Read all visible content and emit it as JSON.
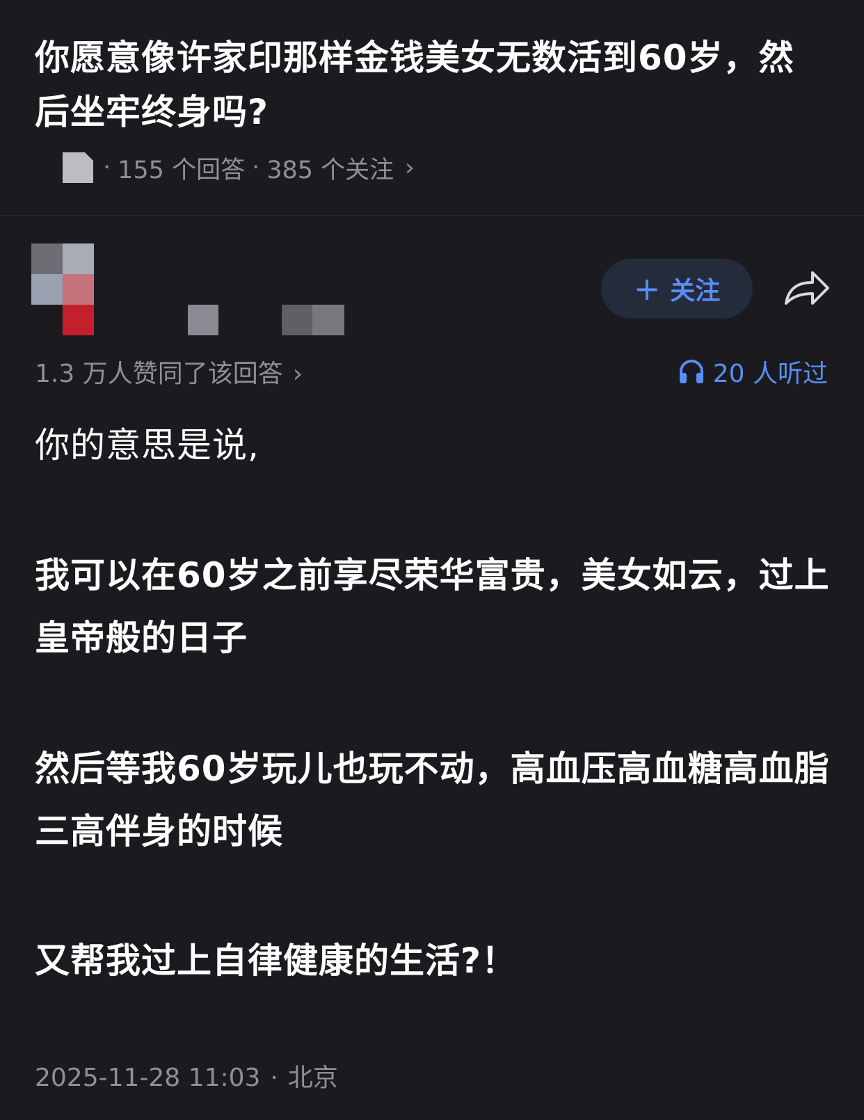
{
  "question": {
    "title": "你愿意像许家印那样金钱美女无数活到60岁，然后坐牢终身吗?",
    "answers_count": "155 个回答",
    "followers_count": "385 个关注",
    "separator": "·",
    "chevron": "›"
  },
  "author": {
    "follow_plus": "+",
    "follow_label": "关注"
  },
  "stats": {
    "upvotes": "1.3 万人赞同了该回答",
    "chevron": "›",
    "listeners": "20 人听过"
  },
  "answer": {
    "paragraphs": [
      "你的意思是说,",
      "我可以在60岁之前享尽荣华富贵，美女如云，过上皇帝般的日子",
      "然后等我60岁玩儿也玩不动，高血压高血糖高血脂三高伴身的时候",
      "又帮我过上自律健康的生活?！"
    ]
  },
  "footer": {
    "datetime": "2025-11-28 11:03",
    "separator": "·",
    "location": "北京"
  },
  "colors": {
    "background": "#1b1b1f",
    "text_primary": "#ffffff",
    "text_secondary": "#8f8f96",
    "accent_blue": "#5a8ef7",
    "follow_button_bg": "#242b3b"
  },
  "icons": {
    "share": "share-arrow-icon",
    "listen": "headphones-icon",
    "question_thumbnail": "document-thumbnail-icon",
    "avatar": "pixelated-avatar"
  }
}
